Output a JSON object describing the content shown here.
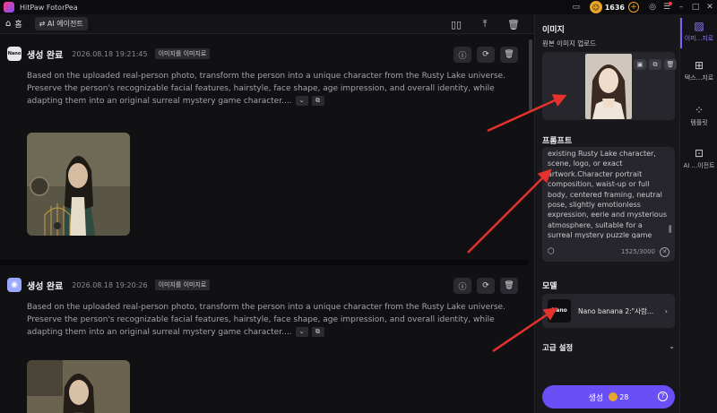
{
  "titlebar": {
    "app_name": "HitPaw FotorPea",
    "coins": "1636"
  },
  "toolbar": {
    "home_label": "홈",
    "ai_tag": "⇄ AI 에이전트"
  },
  "feed": {
    "cards": [
      {
        "status": "생성 완료",
        "timestamp": "2026.08.18   19:21:45",
        "tag": "이미지를 이미지로",
        "model_badge": "Nano",
        "prompt": "Based on the uploaded real-person photo, transform the person into a unique character from the Rusty Lake universe. Preserve the person's recognizable facial features, hairstyle, face shape, age impression, and overall identity, while adapting them into an original surreal mystery game character...."
      },
      {
        "status": "생성 완료",
        "timestamp": "2026.08.18   19:20:26",
        "tag": "이미지를 이미지로",
        "model_badge": "",
        "prompt": "Based on the uploaded real-person photo, transform the person into a unique character from the Rusty Lake universe. Preserve the person's recognizable facial features, hairstyle, face shape, age impression, and overall identity, while adapting them into an original surreal mystery game character...."
      }
    ]
  },
  "panel": {
    "image_section": "이미지",
    "upload_label": "원본 이미지 업로드",
    "prompt_section": "프롬프트",
    "prompt_text": "existing Rusty Lake character, scene, logo, or exact artwork.Character portrait composition, waist-up or full body, centered framing, neutral pose, slightly emotionless expression, eerie and mysterious atmosphere, suitable for a surreal mystery puzzle game character profile.",
    "prompt_counter": "1525/3000",
    "model_section": "모델",
    "model_name": "Nano banana 2:\"사람...",
    "model_thumb": "Nano",
    "advanced_label": "고급 설정",
    "generate_label": "생성",
    "generate_cost": "28"
  },
  "rail": {
    "items": [
      {
        "label": "이미...지로"
      },
      {
        "label": "텍스...지로"
      },
      {
        "label": "템플릿"
      },
      {
        "label": "AI ...이전트"
      }
    ]
  },
  "colors": {
    "accent": "#6a4ef6",
    "coin": "#e8a62b",
    "arrow": "#e5322d"
  }
}
